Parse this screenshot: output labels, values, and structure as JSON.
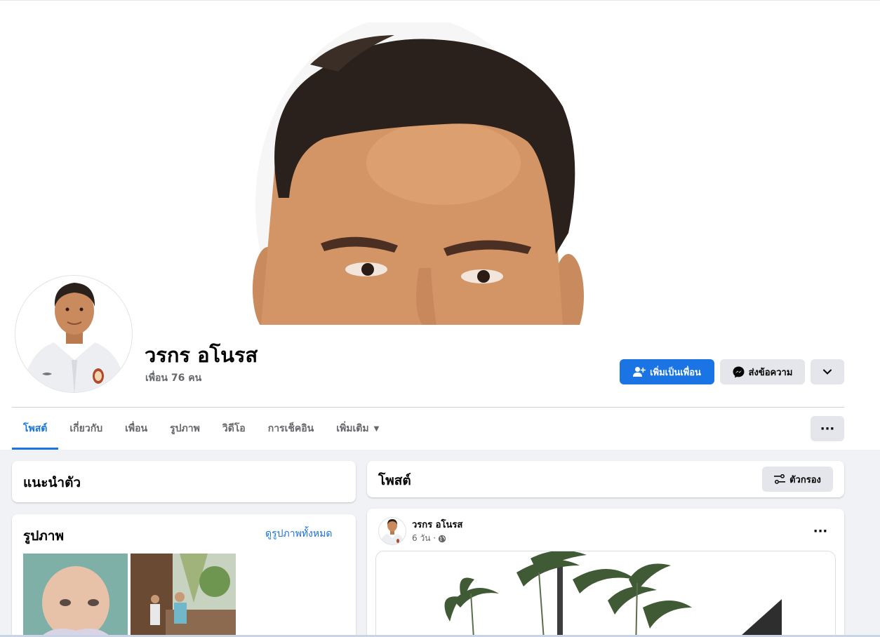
{
  "profile": {
    "name": "วรกร อโนรส",
    "friends": "เพื่อน 76 คน"
  },
  "actions": {
    "add_friend": "เพิ่มเป็นเพื่อน",
    "message": "ส่งข้อความ"
  },
  "tabs": [
    {
      "label": "โพสต์",
      "active": true
    },
    {
      "label": "เกี่ยวกับ"
    },
    {
      "label": "เพื่อน"
    },
    {
      "label": "รูปภาพ"
    },
    {
      "label": "วิดีโอ"
    },
    {
      "label": "การเช็คอิน"
    },
    {
      "label": "เพิ่มเติม"
    }
  ],
  "intro": {
    "title": "แนะนำตัว"
  },
  "photos": {
    "title": "รูปภาพ",
    "see_all": "ดูรูปภาพทั้งหมด"
  },
  "posts": {
    "title": "โพสต์",
    "filter": "ตัวกรอง"
  },
  "post": {
    "author": "วรกร อโนรส",
    "time": "6 วัน ·"
  },
  "colors": {
    "accent": "#1b74e4",
    "background": "#f0f2f5",
    "button_gray": "#e4e6eb",
    "secondary_text": "#65676b"
  }
}
